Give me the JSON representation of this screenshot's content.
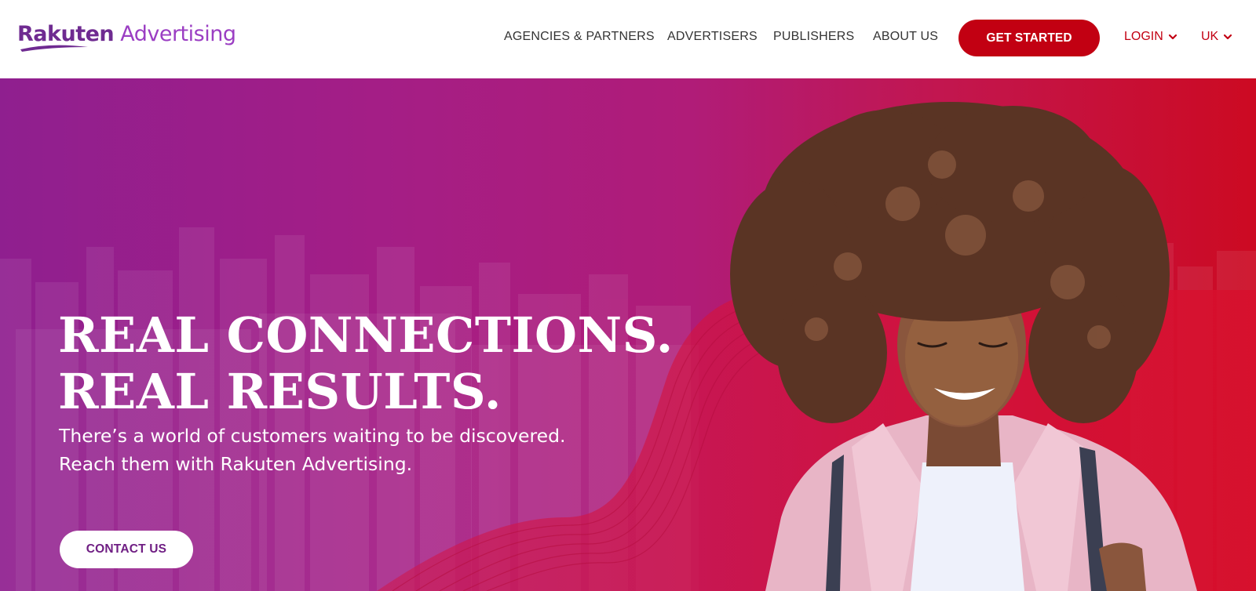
{
  "brand": {
    "logo_text_1": "Rakuten",
    "logo_text_2": " Advertising",
    "primary_color": "#c20012",
    "purple_color": "#6f2b91"
  },
  "nav": {
    "items": [
      {
        "label": "AGENCIES & PARTNERS"
      },
      {
        "label": "ADVERTISERS"
      },
      {
        "label": "PUBLISHERS"
      },
      {
        "label": "ABOUT US"
      }
    ],
    "cta_label": "GET STARTED",
    "login_label": "LOGIN",
    "region_label": "UK",
    "chevron_icon": "chevron-down-icon"
  },
  "hero": {
    "headline_line1": "REAL CONNECTIONS.",
    "headline_line2": "REAL RESULTS.",
    "subline_line1": "There’s a world of customers waiting to be discovered.",
    "subline_line2": "Reach them with Rakuten Advertising.",
    "contact_label": "CONTACT US"
  }
}
